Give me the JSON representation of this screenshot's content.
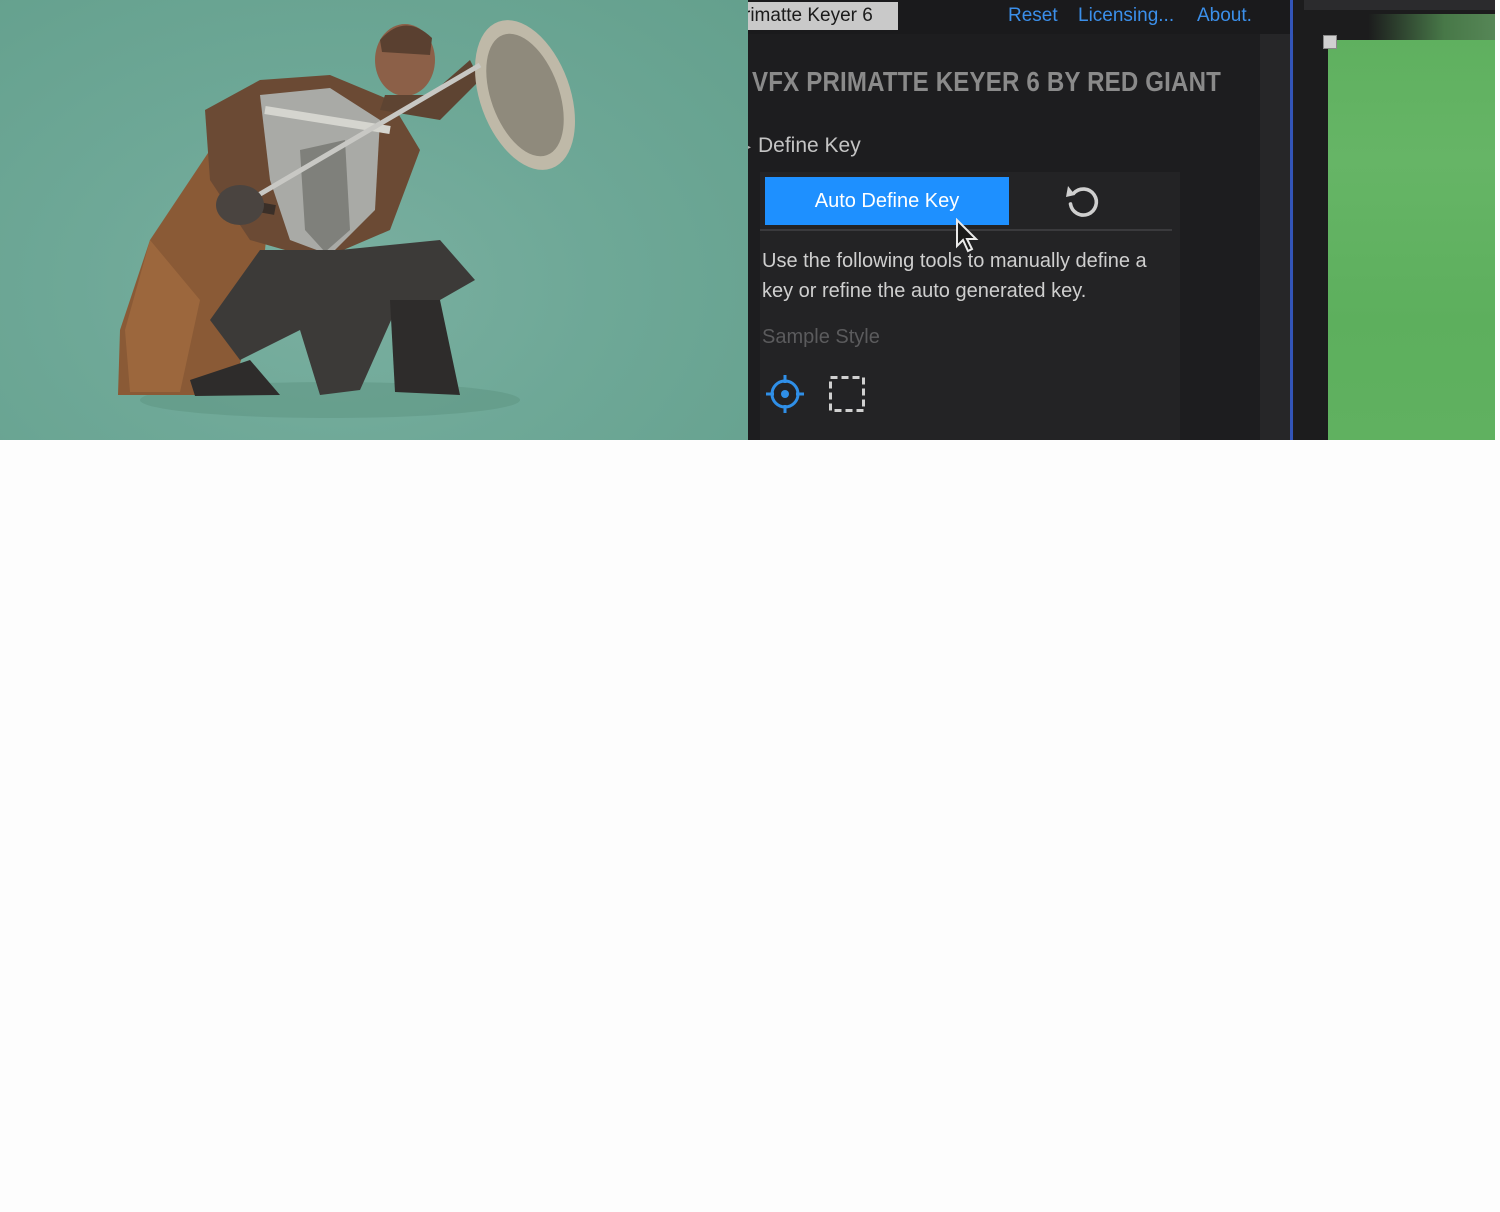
{
  "effect_panel": {
    "effect_name_tab": "rimatte Keyer 6",
    "header_links": {
      "reset": "Reset",
      "licensing": "Licensing...",
      "about": "About."
    },
    "plugin_title": "VFX PRIMATTE KEYER 6 BY RED GIANT",
    "define_key": {
      "toggle_glyph": "▸",
      "label": "Define Key",
      "auto_define_key_button": "Auto Define Key",
      "reset_icon": "reset-arrow-icon",
      "instructions": "Use the following tools to manually define a key or refine the auto generated key.",
      "sample_style_label": "Sample Style",
      "sample_tools": [
        "point-sample-icon",
        "rect-sample-icon"
      ]
    }
  },
  "colors": {
    "accent_blue": "#1e90ff",
    "link_blue": "#3b8fea",
    "panel_bg": "#1d1d1f",
    "keyed_background": "#6ea897",
    "greenscreen": "#60b160"
  },
  "preview": {
    "subject": "kneeling armored warrior with shield"
  }
}
